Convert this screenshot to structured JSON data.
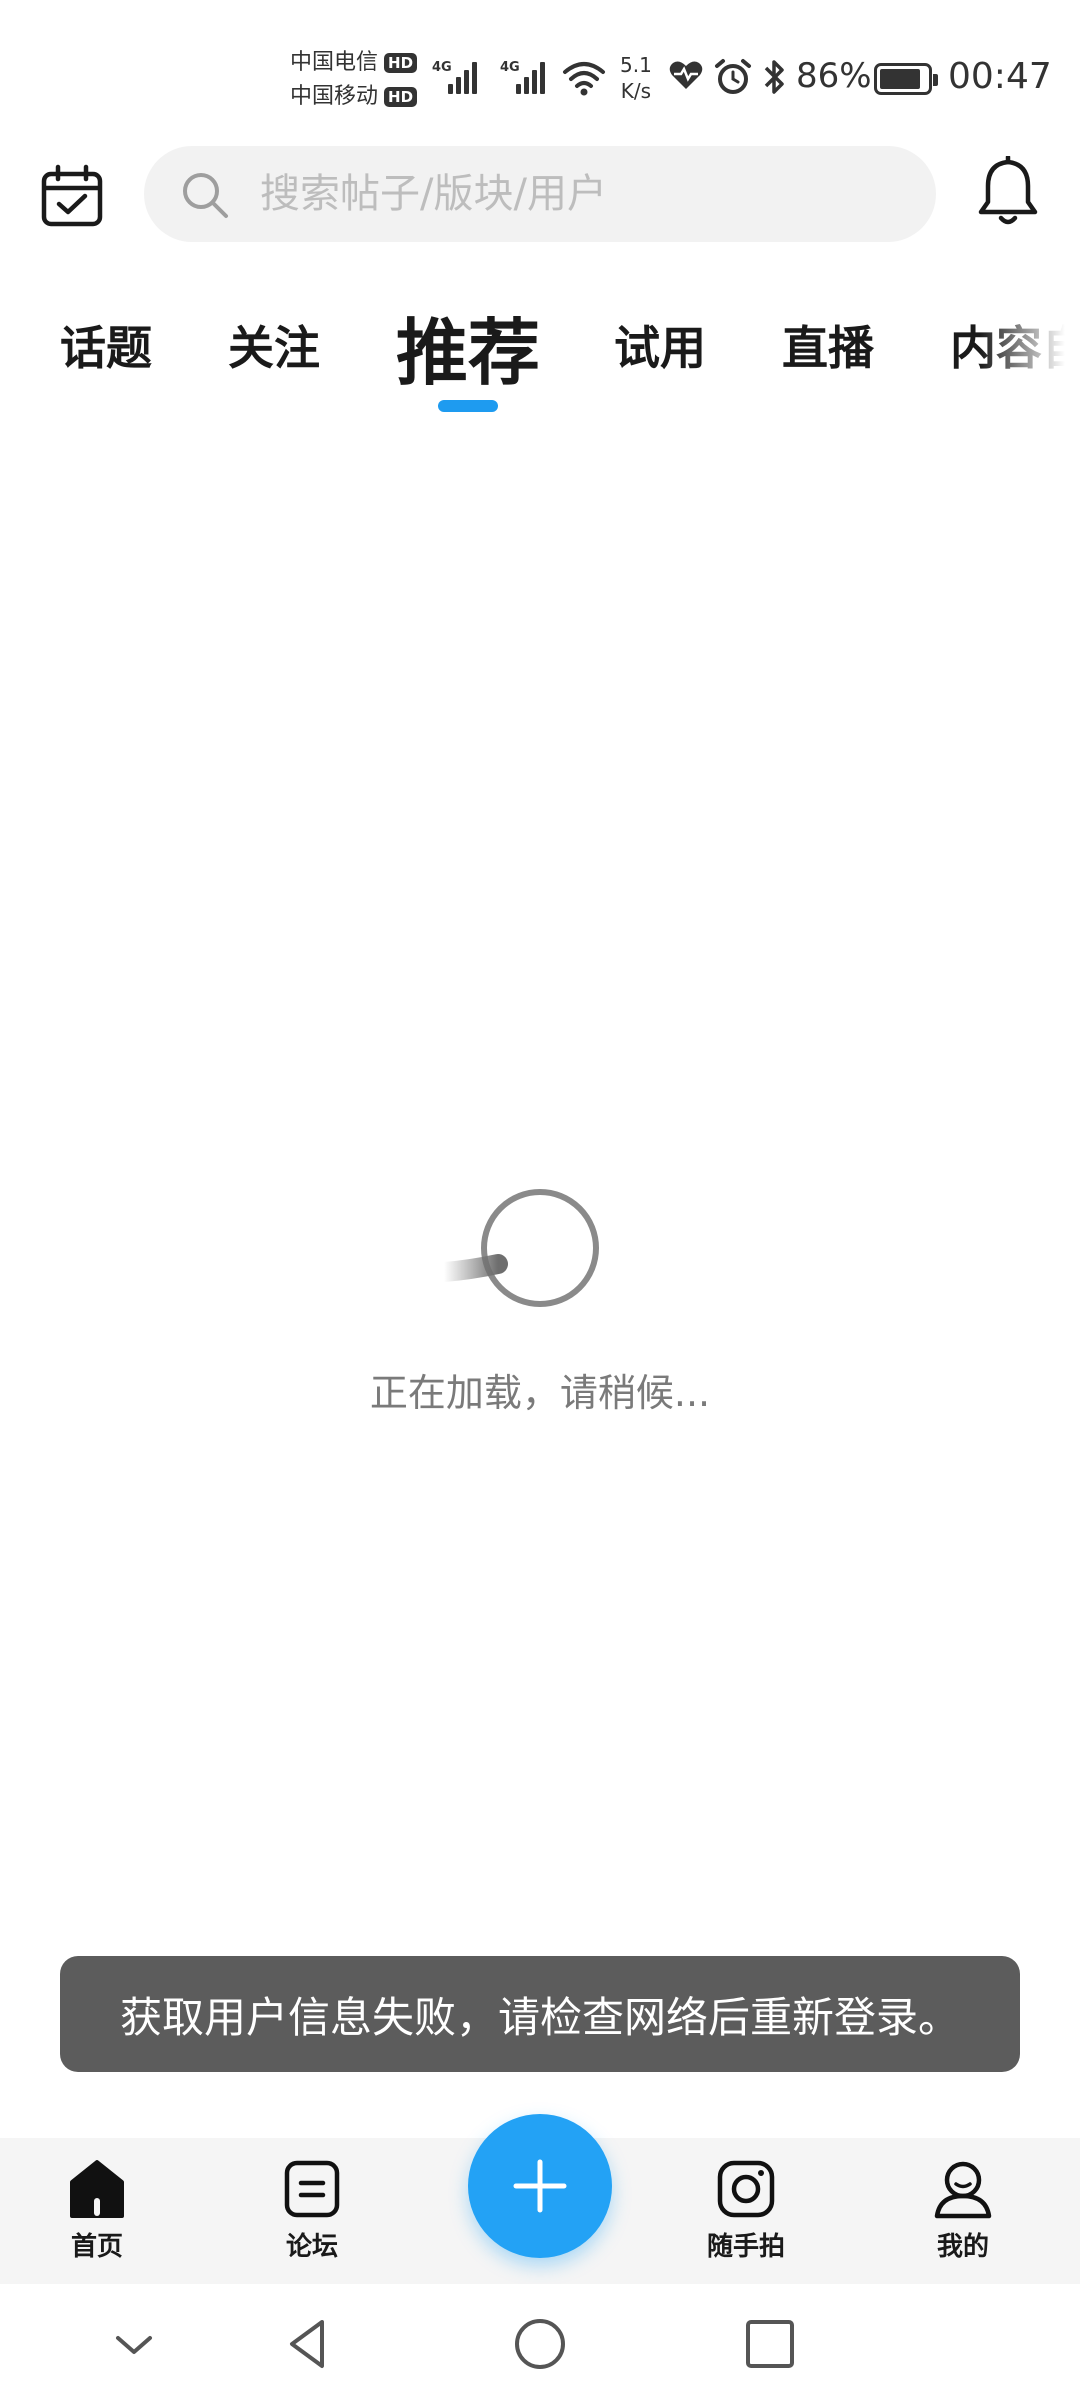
{
  "status_bar": {
    "carrier_1": "中国电信",
    "carrier_2": "中国移动",
    "hd_badge": "HD",
    "signal_label": "4G",
    "net_speed_value": "5.1",
    "net_speed_unit": "K/s",
    "battery_percent": "86%",
    "time": "00:47"
  },
  "header": {
    "search_placeholder": "搜索帖子/版块/用户"
  },
  "tabs": [
    {
      "label": "话题"
    },
    {
      "label": "关注"
    },
    {
      "label": "推荐"
    },
    {
      "label": "试用"
    },
    {
      "label": "直播"
    },
    {
      "label": "内容自"
    }
  ],
  "active_tab": "推荐",
  "loading": {
    "text": "正在加载，请稍候..."
  },
  "toast": {
    "message": "获取用户信息失败，请检查网络后重新登录。"
  },
  "bottom_nav": {
    "items": [
      {
        "label": "首页",
        "icon": "home-icon"
      },
      {
        "label": "论坛",
        "icon": "forum-icon"
      },
      {
        "label": "",
        "icon": "plus-icon"
      },
      {
        "label": "随手拍",
        "icon": "camera-icon"
      },
      {
        "label": "我的",
        "icon": "profile-icon"
      }
    ]
  },
  "colors": {
    "accent": "#1e9bf0",
    "fab": "#23a2f5",
    "toast_bg": "#5c5c5c"
  }
}
